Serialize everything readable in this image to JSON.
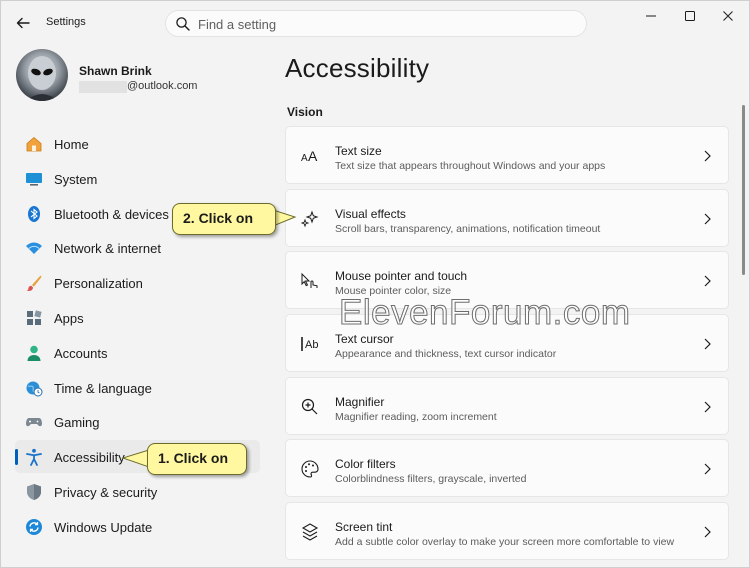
{
  "window": {
    "title": "Settings"
  },
  "search": {
    "placeholder": "Find a setting"
  },
  "profile": {
    "name": "Shawn Brink",
    "email_suffix": "@outlook.com"
  },
  "sidebar": {
    "items": [
      {
        "label": "Home",
        "icon": "home-icon"
      },
      {
        "label": "System",
        "icon": "monitor-icon"
      },
      {
        "label": "Bluetooth & devices",
        "icon": "bluetooth-icon"
      },
      {
        "label": "Network & internet",
        "icon": "wifi-icon"
      },
      {
        "label": "Personalization",
        "icon": "brush-icon"
      },
      {
        "label": "Apps",
        "icon": "apps-icon"
      },
      {
        "label": "Accounts",
        "icon": "person-icon"
      },
      {
        "label": "Time & language",
        "icon": "globe-clock-icon"
      },
      {
        "label": "Gaming",
        "icon": "gamepad-icon"
      },
      {
        "label": "Accessibility",
        "icon": "accessibility-icon",
        "selected": true
      },
      {
        "label": "Privacy & security",
        "icon": "shield-icon"
      },
      {
        "label": "Windows Update",
        "icon": "update-icon"
      }
    ]
  },
  "main": {
    "title": "Accessibility",
    "section": "Vision",
    "cards": [
      {
        "title": "Text size",
        "desc": "Text size that appears throughout Windows and your apps",
        "icon": "text-size-icon"
      },
      {
        "title": "Visual effects",
        "desc": "Scroll bars, transparency, animations, notification timeout",
        "icon": "sparkle-icon"
      },
      {
        "title": "Mouse pointer and touch",
        "desc": "Mouse pointer color, size",
        "icon": "pointer-touch-icon"
      },
      {
        "title": "Text cursor",
        "desc": "Appearance and thickness, text cursor indicator",
        "icon": "text-cursor-icon"
      },
      {
        "title": "Magnifier",
        "desc": "Magnifier reading, zoom increment",
        "icon": "magnifier-icon"
      },
      {
        "title": "Color filters",
        "desc": "Colorblindness filters, grayscale, inverted",
        "icon": "palette-icon"
      },
      {
        "title": "Screen tint",
        "desc": "Add a subtle color overlay to make your screen more comfortable to view",
        "icon": "screen-tint-icon"
      }
    ]
  },
  "callouts": {
    "step1": "1. Click on",
    "step2": "2. Click on"
  },
  "watermark": "ElevenForum.com",
  "colors": {
    "accent": "#005fb8",
    "callout_fill": "#fff8a0"
  }
}
